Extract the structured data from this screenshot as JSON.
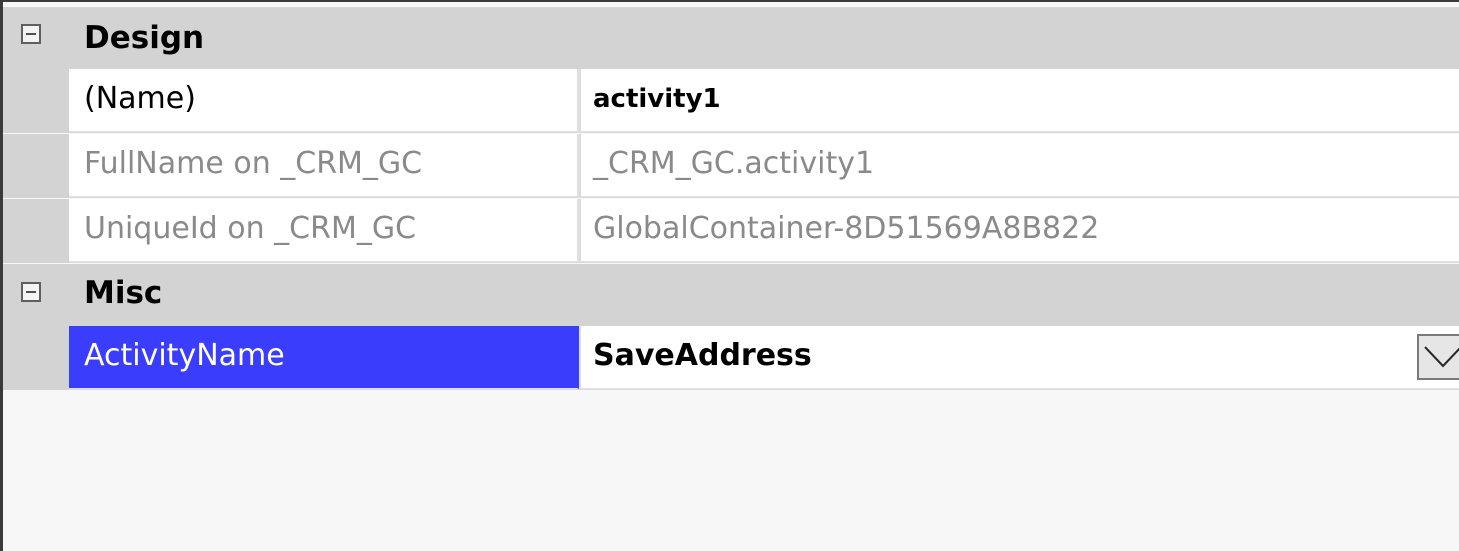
{
  "categories": {
    "design": {
      "label": "Design",
      "properties": [
        {
          "name": "(Name)",
          "value": "activity1"
        },
        {
          "name": "FullName on _CRM_GC",
          "value": "_CRM_GC.activity1"
        },
        {
          "name": "UniqueId on _CRM_GC",
          "value": "GlobalContainer-8D51569A8B822"
        }
      ]
    },
    "misc": {
      "label": "Misc",
      "properties": [
        {
          "name": "ActivityName",
          "value": "SaveAddress"
        }
      ]
    }
  },
  "colors": {
    "selection": "#3a3dfc",
    "category_background": "#d3d3d3",
    "readonly_text": "#8a8a8a"
  },
  "icons": {
    "collapse": "minus-box-icon",
    "dropdown": "chevron-down-icon"
  }
}
